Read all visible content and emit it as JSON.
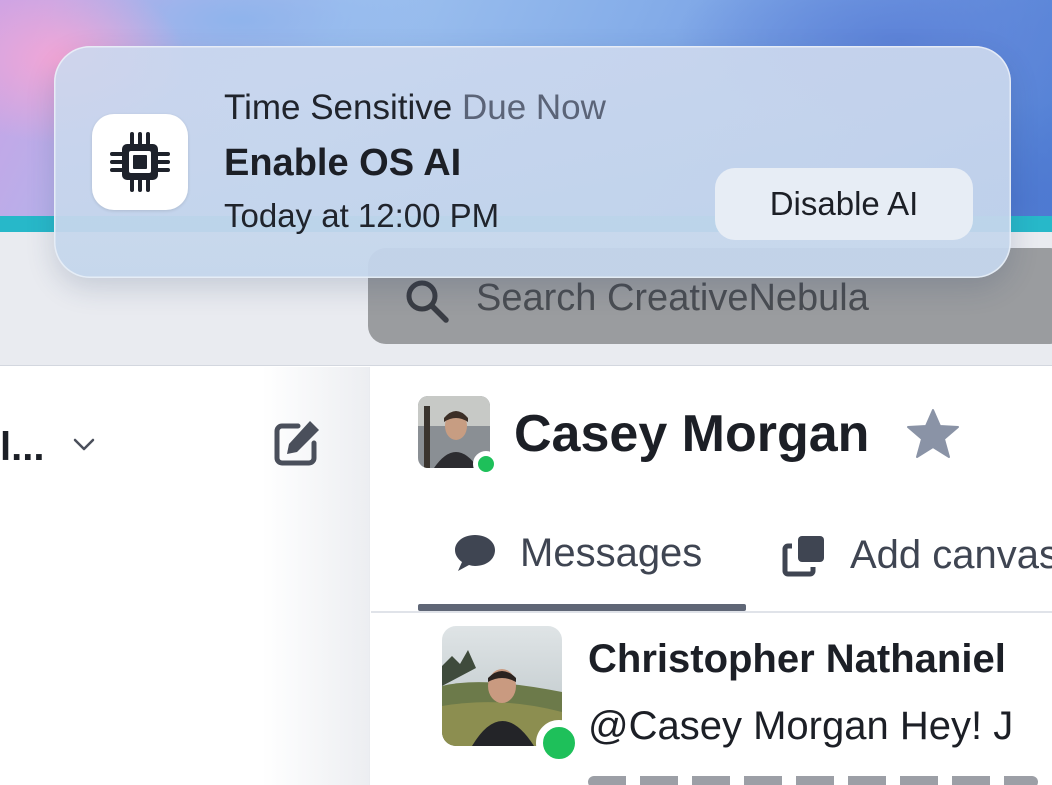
{
  "notification": {
    "category": "Time Sensitive",
    "status": "Due Now",
    "title": "Enable OS AI",
    "time": "Today at 12:00 PM",
    "action_label": "Disable AI",
    "icon": "cpu-chip-icon"
  },
  "search": {
    "placeholder": "Search CreativeNebula",
    "icon": "search-icon"
  },
  "sidebar": {
    "workspace_name": "l...",
    "icons": [
      "chevron-down-icon",
      "compose-icon"
    ]
  },
  "channel": {
    "name": "Casey Morgan",
    "starred": false,
    "presence_color": "#1ec05a",
    "tabs": [
      {
        "label": "Messages",
        "icon": "chat-bubble-icon",
        "active": true
      },
      {
        "label": "Add canvas",
        "icon": "canvas-copy-icon",
        "active": false
      }
    ]
  },
  "message": {
    "sender": "Christopher Nathaniel",
    "text": "@Casey Morgan Hey! J"
  },
  "colors": {
    "accent_teal": "#27b8c9",
    "online_green": "#1ec05a"
  }
}
